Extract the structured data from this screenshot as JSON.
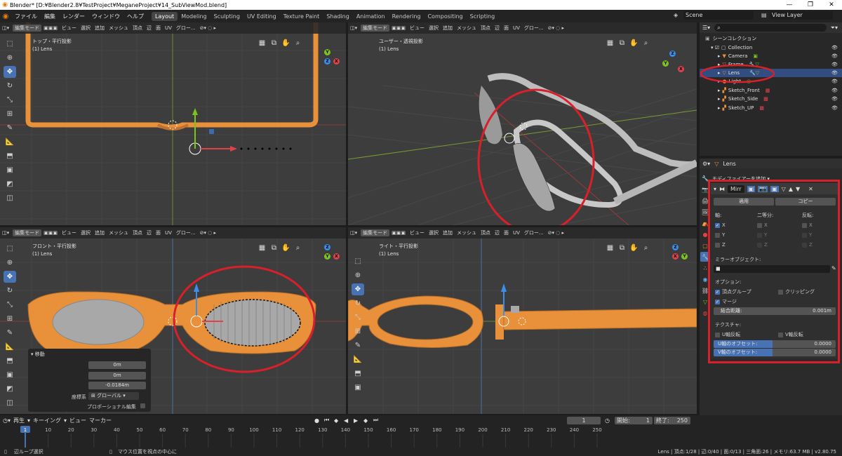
{
  "titlebar": {
    "title": "Blender* [D:¥Blender2.8¥TestProject¥MeganeProject¥14_SubViewMod.blend]"
  },
  "menu": [
    "ファイル",
    "編集",
    "レンダー",
    "ウィンドウ",
    "ヘルプ"
  ],
  "workspaces": [
    "Layout",
    "Modeling",
    "Sculpting",
    "UV Editing",
    "Texture Paint",
    "Shading",
    "Animation",
    "Rendering",
    "Compositing",
    "Scripting"
  ],
  "active_workspace": "Layout",
  "scene": {
    "scene_name": "Scene",
    "view_layer": "View Layer"
  },
  "viewport_header": {
    "mode": "編集モード",
    "menus": [
      "ビュー",
      "選択",
      "追加",
      "メッシュ",
      "頂点",
      "辺",
      "面",
      "UV"
    ],
    "orientation": "グロー..."
  },
  "viewports": [
    {
      "view": "トップ・平行投影",
      "object": "(1) Lens"
    },
    {
      "view": "ユーザー・透視投影",
      "object": "(1) Lens"
    },
    {
      "view": "フロント・平行投影",
      "object": "(1) Lens"
    },
    {
      "view": "ライト・平行投影",
      "object": "(1) Lens"
    }
  ],
  "gizmo_labels": {
    "x": "X",
    "y": "Y",
    "z": "Z"
  },
  "redo_panel": {
    "title": "移動",
    "rows": [
      {
        "label": "移動 X",
        "value": "0m"
      },
      {
        "label": "Y",
        "value": "0m"
      },
      {
        "label": "Z",
        "value": "-0.0184m"
      }
    ],
    "orient_label": "座標系",
    "orient_value": "グローバル",
    "proportional": "プロポーショナル編集"
  },
  "outliner": {
    "root": "シーンコレクション",
    "items": [
      {
        "name": "Collection",
        "level": 0
      },
      {
        "name": "Camera",
        "level": 1
      },
      {
        "name": "Frame",
        "level": 1
      },
      {
        "name": "Lens",
        "level": 1
      },
      {
        "name": "Light",
        "level": 1
      },
      {
        "name": "Sketch_Front",
        "level": 1
      },
      {
        "name": "Sketch_Side",
        "level": 1
      },
      {
        "name": "Sketch_UP",
        "level": 1
      }
    ],
    "selected": "Lens"
  },
  "properties": {
    "object_name": "Lens",
    "add_modifier": "モディファイアーを追加",
    "modifier_name": "Mirr",
    "apply": "適用",
    "copy": "コピー",
    "axis_label": "軸:",
    "bisect_label": "二等分:",
    "flip_label": "反転:",
    "axes": [
      "X",
      "Y",
      "Z"
    ],
    "axis_checked": [
      true,
      false,
      false
    ],
    "mirror_object_label": "ミラーオブジェクト:",
    "options_label": "オプション:",
    "vertex_groups": "頂点グループ",
    "clipping": "クリッピング",
    "merge": "マージ",
    "merge_distance_label": "結合距離:",
    "merge_distance": "0.001m",
    "texture_label": "テクスチャ:",
    "u_flip": "U軸反転",
    "v_flip": "V軸反転",
    "u_offset_label": "U軸のオフセット:",
    "u_offset": "0.0000",
    "v_offset_label": "V軸のオフセット:",
    "v_offset": "0.0000"
  },
  "timeline": {
    "menus": [
      "再生",
      "キーイング",
      "ビュー",
      "マーカー"
    ],
    "current_frame": "1",
    "start_label": "開始:",
    "start": "1",
    "end_label": "終了:",
    "end": "250",
    "ticks": [
      "1",
      "10",
      "20",
      "30",
      "40",
      "50",
      "60",
      "70",
      "80",
      "90",
      "100",
      "110",
      "120",
      "130",
      "140",
      "150",
      "160",
      "170",
      "180",
      "190",
      "200",
      "210",
      "220",
      "230",
      "240",
      "250"
    ]
  },
  "statusbar": {
    "left": "辺ループ選択",
    "middle": "マウス位置を視点の中心に",
    "right": "Lens | 頂点:1/28 | 辺:0/40 | 面:0/13 | 三角面:26 | メモリ:63.7 MB | v2.80.75"
  },
  "colors": {
    "accent": "#4772b3",
    "frame_orange": "#e8913a",
    "lens_gray": "#a0a0a0",
    "red_annotation": "#d8202a"
  }
}
